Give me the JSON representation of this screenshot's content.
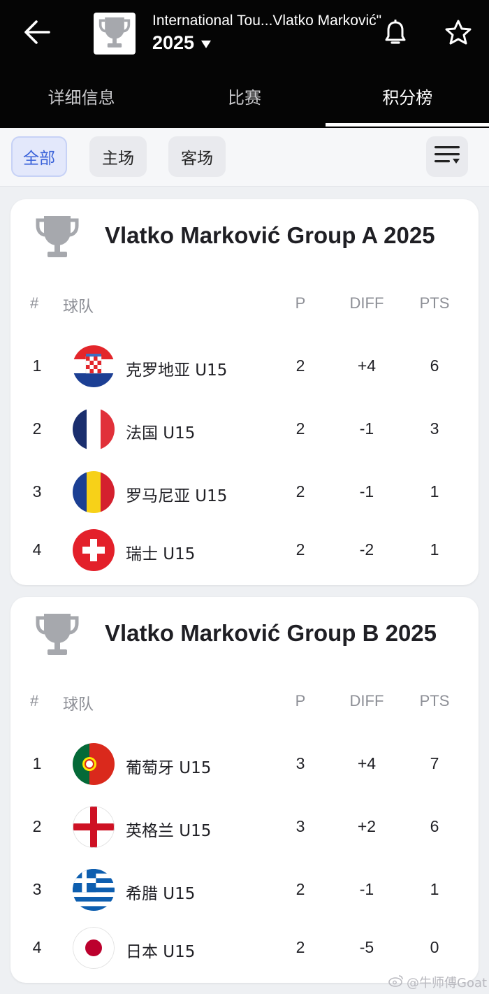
{
  "header": {
    "title": "International Tou...Vlatko Marković\"",
    "season": "2025",
    "icons": {
      "back": "arrow-left-icon",
      "logo": "trophy-icon",
      "notify": "bell-icon",
      "favorite": "star-icon"
    }
  },
  "tabs": [
    {
      "label": "详细信息",
      "active": false
    },
    {
      "label": "比赛",
      "active": false
    },
    {
      "label": "积分榜",
      "active": true
    }
  ],
  "filters": [
    {
      "label": "全部",
      "active": true
    },
    {
      "label": "主场",
      "active": false
    },
    {
      "label": "客场",
      "active": false
    }
  ],
  "columns": {
    "rank": "#",
    "team": "球队",
    "played": "P",
    "diff": "DIFF",
    "points": "PTS"
  },
  "groups": [
    {
      "title": "Vlatko Marković Group A 2025",
      "rows": [
        {
          "rank": "1",
          "team": "克罗地亚 U15",
          "flag": "croatia",
          "p": "2",
          "diff": "+4",
          "pts": "6"
        },
        {
          "rank": "2",
          "team": "法国 U15",
          "flag": "france",
          "p": "2",
          "diff": "-1",
          "pts": "3"
        },
        {
          "rank": "3",
          "team": "罗马尼亚 U15",
          "flag": "romania",
          "p": "2",
          "diff": "-1",
          "pts": "1"
        },
        {
          "rank": "4",
          "team": "瑞士 U15",
          "flag": "switzerland",
          "p": "2",
          "diff": "-2",
          "pts": "1"
        }
      ]
    },
    {
      "title": "Vlatko Marković Group B 2025",
      "rows": [
        {
          "rank": "1",
          "team": "葡萄牙 U15",
          "flag": "portugal",
          "p": "3",
          "diff": "+4",
          "pts": "7"
        },
        {
          "rank": "2",
          "team": "英格兰 U15",
          "flag": "england",
          "p": "3",
          "diff": "+2",
          "pts": "6"
        },
        {
          "rank": "3",
          "team": "希腊 U15",
          "flag": "greece",
          "p": "2",
          "diff": "-1",
          "pts": "1"
        },
        {
          "rank": "4",
          "team": "日本 U15",
          "flag": "japan",
          "p": "2",
          "diff": "-5",
          "pts": "0"
        }
      ]
    }
  ],
  "watermark": "@牛师傅Goat",
  "colors": {
    "topbar": "#050505",
    "accent": "#3a62d9",
    "background": "#eef0f3"
  }
}
